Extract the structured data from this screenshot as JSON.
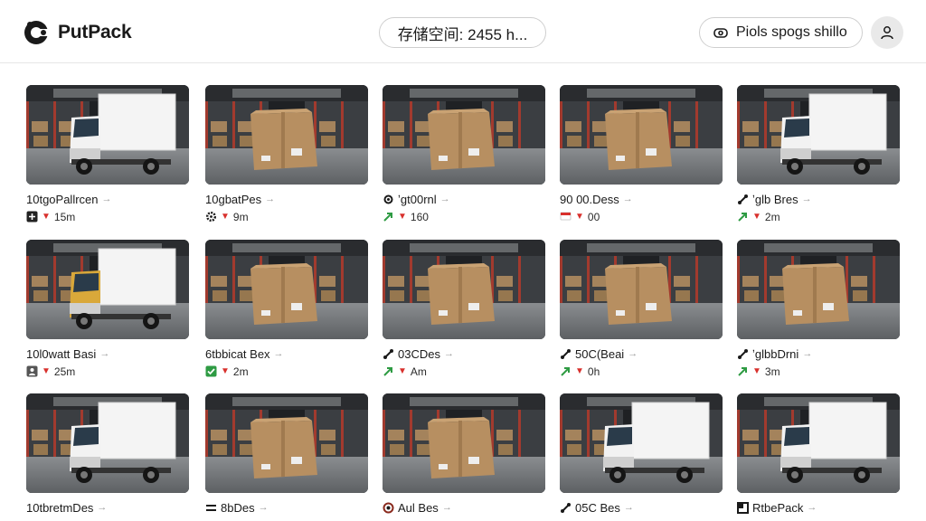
{
  "app": {
    "name": "PutPack"
  },
  "storage": {
    "label": "存储空间: 2455 h..."
  },
  "action": {
    "label": "Piols spogs shillo",
    "icon": "tag-icon"
  },
  "user": {
    "icon": "user-icon"
  },
  "colors": {
    "green": "#2e9b43",
    "red": "#d8302c",
    "text": "#1a1a1a"
  },
  "cards": [
    {
      "thumb": "white-truck",
      "title": "10tgoPallrcen",
      "title_icon": "",
      "meta_icon": "plus-square-icon",
      "meta": "15m"
    },
    {
      "thumb": "box",
      "title": "10gbatPes",
      "title_icon": "",
      "meta_icon": "gear-icon",
      "meta": "9m"
    },
    {
      "thumb": "box",
      "title": "ʼgt00rnl",
      "title_icon": "gear-icon",
      "meta_icon": "green-arrow-icon",
      "meta": "160"
    },
    {
      "thumb": "box",
      "title": "90 00.Dess",
      "title_icon": "",
      "meta_icon": "red-flag-icon",
      "meta": "00"
    },
    {
      "thumb": "white-truck",
      "title": "ʼglb Bres",
      "title_icon": "link-icon",
      "meta_icon": "green-arrow-icon",
      "meta": "2m"
    },
    {
      "thumb": "yellow-truck",
      "title": "10l0watt Basi",
      "title_icon": "",
      "meta_icon": "person-square-icon",
      "meta": "25m"
    },
    {
      "thumb": "box",
      "title": "6tbbicat Bex",
      "title_icon": "",
      "meta_icon": "green-check-icon",
      "meta": "2m"
    },
    {
      "thumb": "box",
      "title": "03CDes",
      "title_icon": "link-icon",
      "meta_icon": "green-arrow-icon",
      "meta": "Am"
    },
    {
      "thumb": "box",
      "title": "50C(Beai",
      "title_icon": "link-icon",
      "meta_icon": "green-arrow-icon",
      "meta": "0h"
    },
    {
      "thumb": "box",
      "title": "ʼglbbDrni",
      "title_icon": "link-icon",
      "meta_icon": "green-arrow-icon",
      "meta": "3m"
    },
    {
      "thumb": "white-truck",
      "title": "10tbretmDes",
      "title_icon": "",
      "meta_icon": "",
      "meta": ""
    },
    {
      "thumb": "box",
      "title": "8bDes",
      "title_icon": "list-icon",
      "meta_icon": "",
      "meta": ""
    },
    {
      "thumb": "box",
      "title": "Aul Bes",
      "title_icon": "pin-icon",
      "meta_icon": "",
      "meta": ""
    },
    {
      "thumb": "white-truck",
      "title": "05C Bes",
      "title_icon": "link-icon",
      "meta_icon": "",
      "meta": ""
    },
    {
      "thumb": "white-truck",
      "title": "RtbePack",
      "title_icon": "pack-icon",
      "meta_icon": "",
      "meta": ""
    }
  ]
}
